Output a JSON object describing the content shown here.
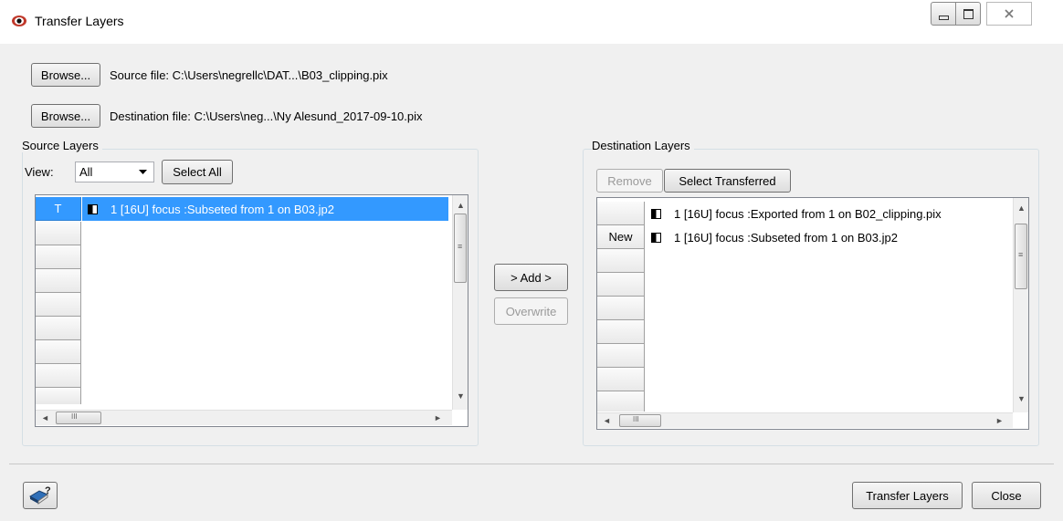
{
  "window": {
    "title": "Transfer Layers"
  },
  "source": {
    "browse_label": "Browse...",
    "file_text": "Source file: C:\\Users\\negrellc\\DAT...\\B03_clipping.pix",
    "group_title": "Source Layers",
    "view_label": "View:",
    "view_value": "All",
    "select_all_label": "Select All",
    "rows": [
      {
        "marker": "T",
        "text": "1 [16U]  focus  :Subseted from 1 on B03.jp2",
        "selected": true
      }
    ],
    "empty_rows": 7
  },
  "destination": {
    "browse_label": "Browse...",
    "file_text": "Destination file: C:\\Users\\neg...\\Ny Alesund_2017-09-10.pix",
    "group_title": "Destination Layers",
    "remove_label": "Remove",
    "select_transferred_label": "Select Transferred",
    "rows": [
      {
        "marker": "",
        "text": "1 [16U]  focus  :Exported from 1 on B02_clipping.pix"
      },
      {
        "marker": "New",
        "text": "1 [16U]  focus  :Subseted from 1 on B03.jp2"
      }
    ],
    "empty_rows": 6
  },
  "middle": {
    "add_label": "> Add >",
    "overwrite_label": "Overwrite"
  },
  "footer": {
    "transfer_label": "Transfer Layers",
    "close_label": "Close"
  },
  "scroll_glyphs": {
    "up": "▲",
    "down": "▼",
    "left": "◄",
    "right": "►",
    "grip_v": "≡",
    "grip_h": "III"
  }
}
